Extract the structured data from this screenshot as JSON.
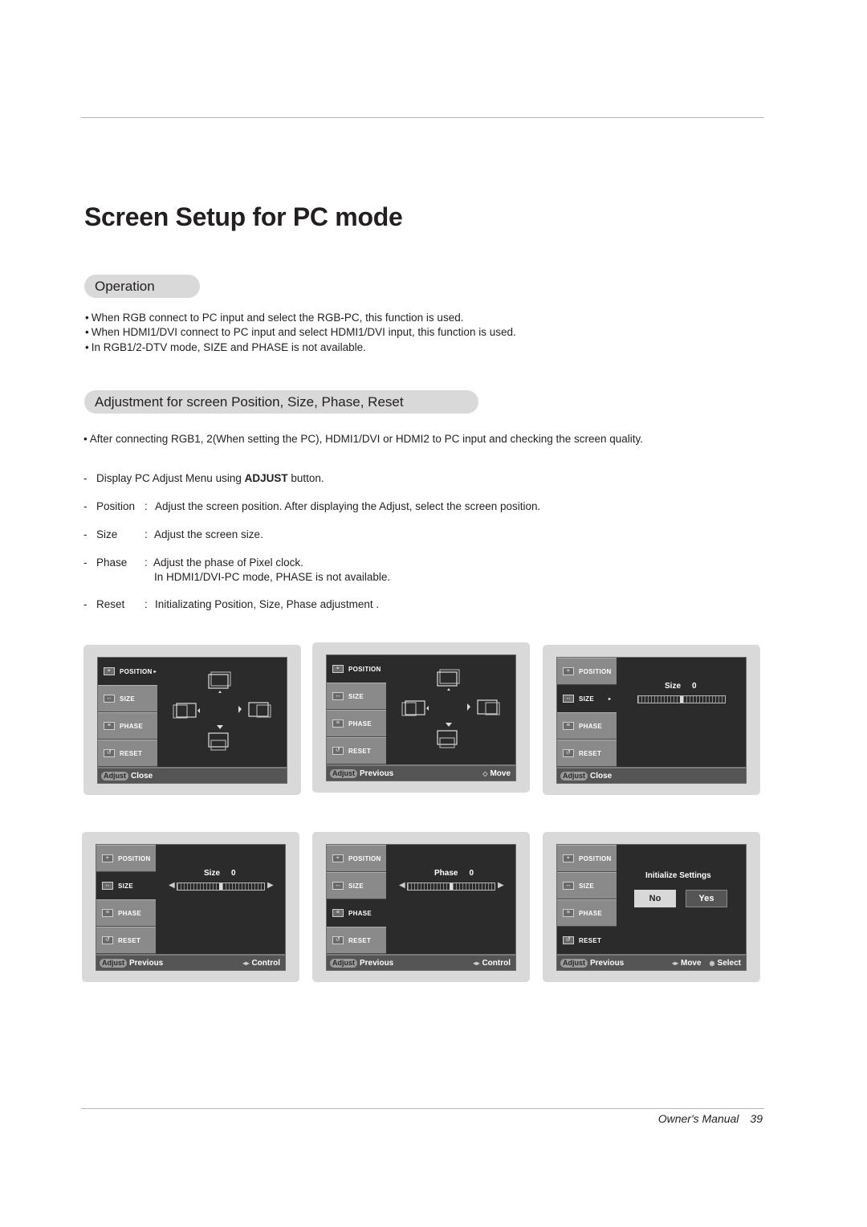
{
  "page_title": "Screen Setup for PC mode",
  "sections": {
    "operation": {
      "heading": "Operation",
      "bullets": [
        "When RGB connect to PC input and select the RGB-PC, this function is used.",
        "When HDMI1/DVI connect to PC input and select HDMI1/DVI input, this function is used.",
        "In RGB1/2-DTV mode, SIZE and PHASE is not available."
      ]
    },
    "adjustment": {
      "heading": "Adjustment for screen Position, Size, Phase, Reset",
      "intro": "After connecting RGB1, 2(When setting the PC), HDMI1/DVI or HDMI2 to PC input and checking the screen quality.",
      "step0": {
        "prefix": "Display PC Adjust Menu using ",
        "bold": "ADJUST",
        "suffix": " button."
      },
      "steps": [
        {
          "term": "Position",
          "desc": "Adjust the screen position. After displaying the Adjust, select the screen position.",
          "desc2": ""
        },
        {
          "term": "Size",
          "desc": "Adjust the screen size.",
          "desc2": ""
        },
        {
          "term": "Phase",
          "desc": "Adjust the phase of Pixel clock.",
          "desc2": "In HDMI1/DVI-PC mode, PHASE is not available."
        },
        {
          "term": "Reset",
          "desc": "Initializating Position, Size, Phase adjustment .",
          "desc2": ""
        }
      ]
    }
  },
  "osd": {
    "menu_items": [
      "POSITION",
      "SIZE",
      "PHASE",
      "RESET"
    ],
    "adjust_badge": "Adjust",
    "screens": [
      {
        "active": "POSITION",
        "footer_left": "Close",
        "footer_right": []
      },
      {
        "active": "POSITION",
        "footer_left": "Previous",
        "footer_right": [
          {
            "glyph": "◇",
            "label": "Move"
          }
        ]
      },
      {
        "active": "SIZE",
        "footer_left": "Close",
        "footer_right": [],
        "slider": {
          "label": "Size",
          "value": "0",
          "level": 0.5
        }
      },
      {
        "active": "SIZE",
        "footer_left": "Previous",
        "footer_right": [
          {
            "glyph": "◂▸",
            "label": "Control"
          }
        ],
        "slider": {
          "label": "Size",
          "value": "0",
          "level": 0.5
        }
      },
      {
        "active": "PHASE",
        "footer_left": "Previous",
        "footer_right": [
          {
            "glyph": "◂▸",
            "label": "Control"
          }
        ],
        "slider": {
          "label": "Phase",
          "value": "0",
          "level": 0.5
        }
      },
      {
        "active": "RESET",
        "footer_left": "Previous",
        "footer_right": [
          {
            "glyph": "◂▸",
            "label": "Move"
          },
          {
            "glyph": "◉",
            "label": "Select"
          }
        ],
        "dialog": {
          "title": "Initialize Settings",
          "no": "No",
          "yes": "Yes",
          "selected": "No"
        }
      }
    ]
  },
  "footer": {
    "label": "Owner's Manual",
    "page": "39"
  }
}
